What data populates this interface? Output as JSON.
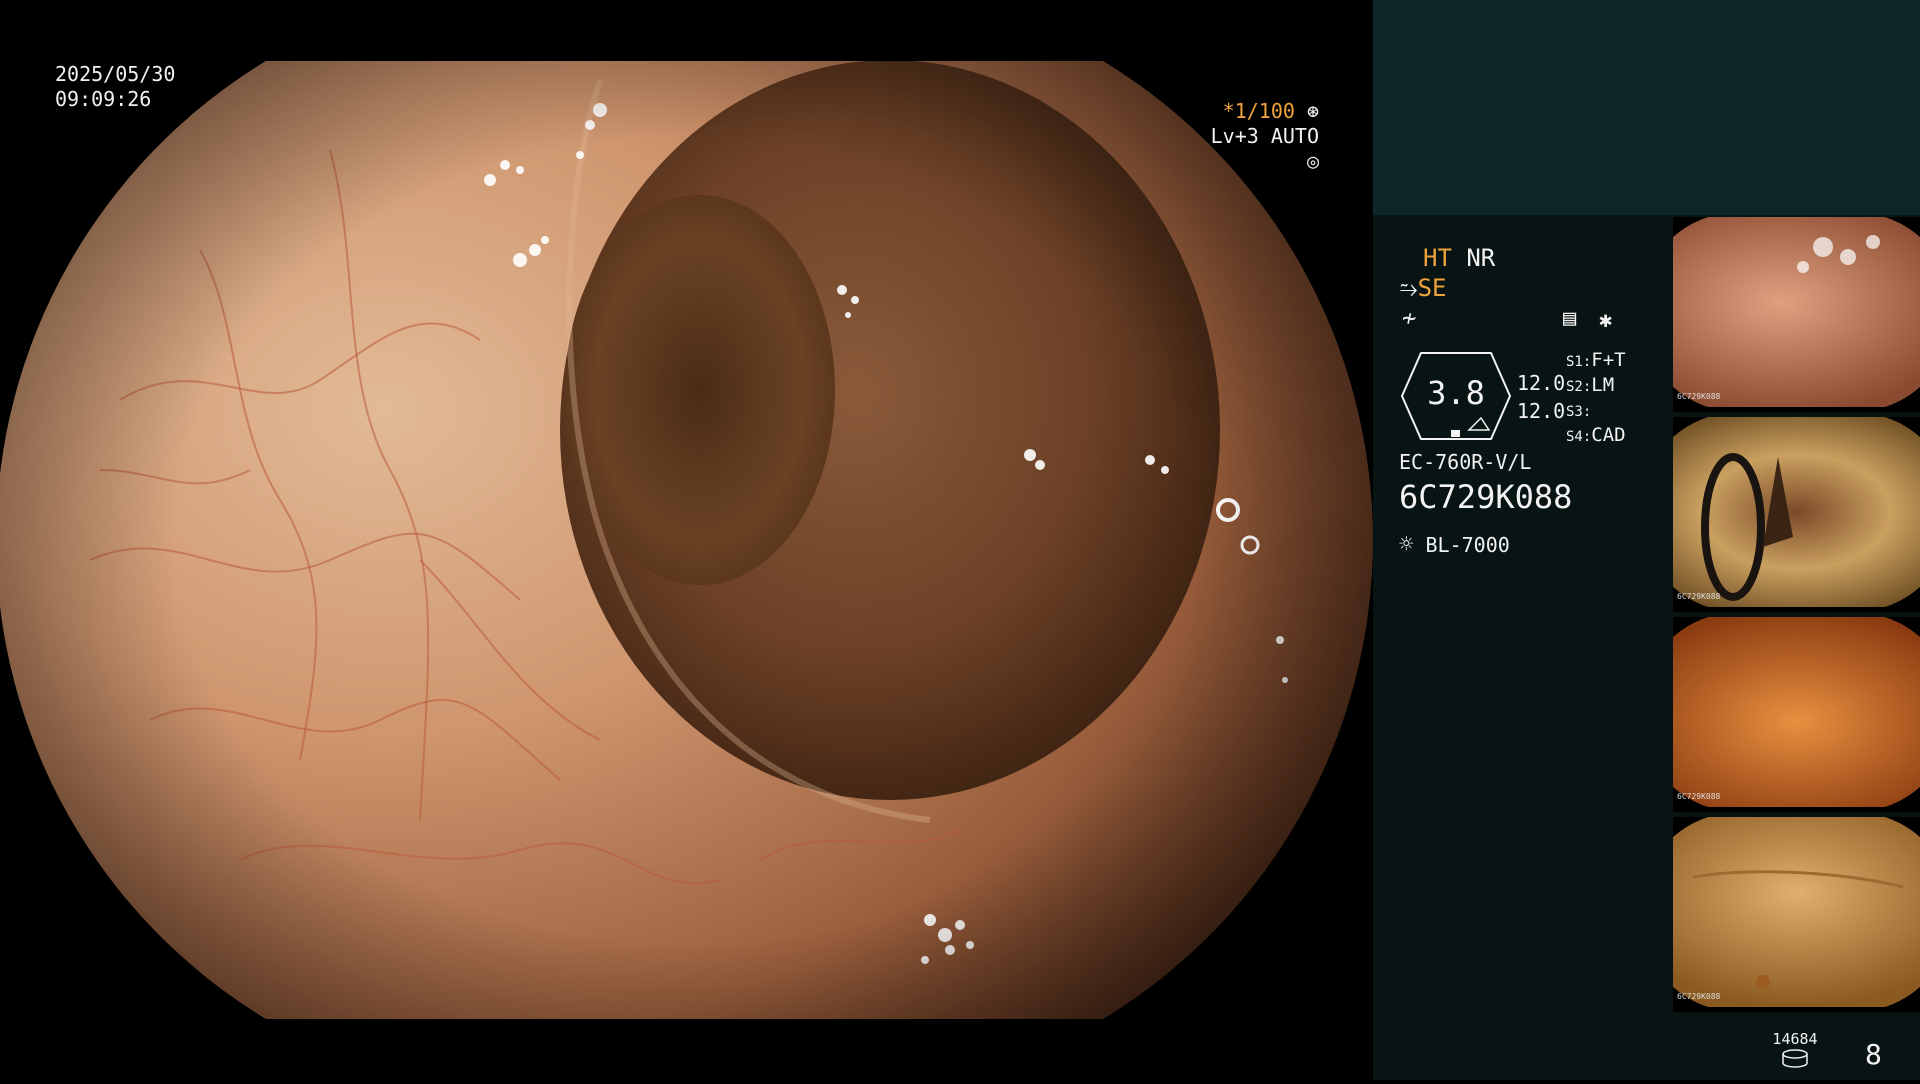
{
  "overlay": {
    "date": "2025/05/30",
    "time": "09:09:26",
    "shutter": "*1/100",
    "enhance": "Lv+3 AUTO"
  },
  "panel": {
    "ht": "HT",
    "nr": "NR",
    "se": "SE",
    "zoom_value": "3.8",
    "values": [
      "12.0",
      "12.0"
    ],
    "scope_settings": [
      {
        "key": "S1:",
        "value": "F+T"
      },
      {
        "key": "S2:",
        "value": "LM"
      },
      {
        "key": "S3:",
        "value": ""
      },
      {
        "key": "S4:",
        "value": "CAD"
      }
    ],
    "scope_model": "EC-760R-V/L",
    "serial": "6C729K088",
    "light_source": "BL-7000",
    "storage_count": "14684",
    "image_count": "8"
  },
  "thumbnails": [
    {
      "label": "6C729K088",
      "tint": "#d08a68"
    },
    {
      "label": "6C729K088",
      "tint": "#c99a5a"
    },
    {
      "label": "6C729K088",
      "tint": "#d0701f"
    },
    {
      "label": "6C729K088",
      "tint": "#c8903e"
    }
  ],
  "colors": {
    "accent_orange": "#f0a33a",
    "panel_bg": "#081313",
    "panel_top_bg": "#0d2525"
  },
  "icons": [
    "shutter-icon",
    "enhance-icon",
    "structure-icon",
    "filter-icon",
    "settings-icon",
    "asterisk-icon",
    "light-source-icon",
    "storage-icon"
  ]
}
